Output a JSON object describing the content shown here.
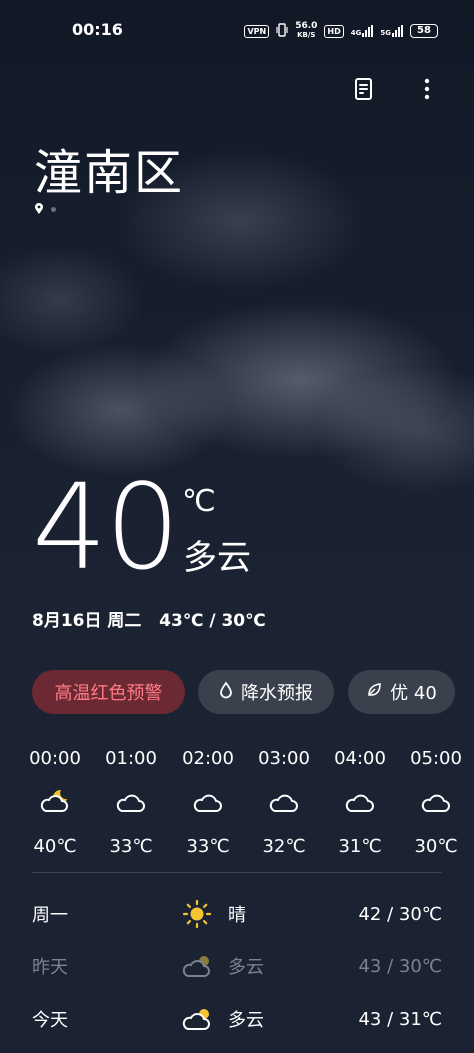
{
  "status_bar": {
    "time": "00:16",
    "vpn": "VPN",
    "speed_value": "56.0",
    "speed_unit": "KB/S",
    "hd": "HD",
    "network1": "4G",
    "network2": "5G",
    "battery": "58"
  },
  "location": {
    "city": "潼南区"
  },
  "current": {
    "temperature": "40",
    "unit": "℃",
    "condition": "多云",
    "date_line": "8月16日 周二",
    "high_low": "43℃ / 30℃"
  },
  "chips": {
    "alert": "高温红色预警",
    "rain": "降水预报",
    "aqi": "优 40"
  },
  "hourly": [
    {
      "time": "00:00",
      "temp": "40℃",
      "icon": "cloud-moon-icon"
    },
    {
      "time": "01:00",
      "temp": "33℃",
      "icon": "cloud-icon"
    },
    {
      "time": "02:00",
      "temp": "33℃",
      "icon": "cloud-icon"
    },
    {
      "time": "03:00",
      "temp": "32℃",
      "icon": "cloud-icon"
    },
    {
      "time": "04:00",
      "temp": "31℃",
      "icon": "cloud-icon"
    },
    {
      "time": "05:00",
      "temp": "30℃",
      "icon": "cloud-icon"
    }
  ],
  "daily": [
    {
      "day": "周一",
      "condition": "晴",
      "high": "42",
      "low": "30℃",
      "icon": "sun-icon"
    },
    {
      "day": "昨天",
      "condition": "多云",
      "high": "43",
      "low": "30℃",
      "icon": "cloud-sun-icon"
    },
    {
      "day": "今天",
      "condition": "多云",
      "high": "43",
      "low": "31℃",
      "icon": "cloud-sun-icon"
    }
  ],
  "colors": {
    "alert_bg": "#6b2a33",
    "alert_text": "#ff7a86",
    "sun": "#f5c431"
  }
}
